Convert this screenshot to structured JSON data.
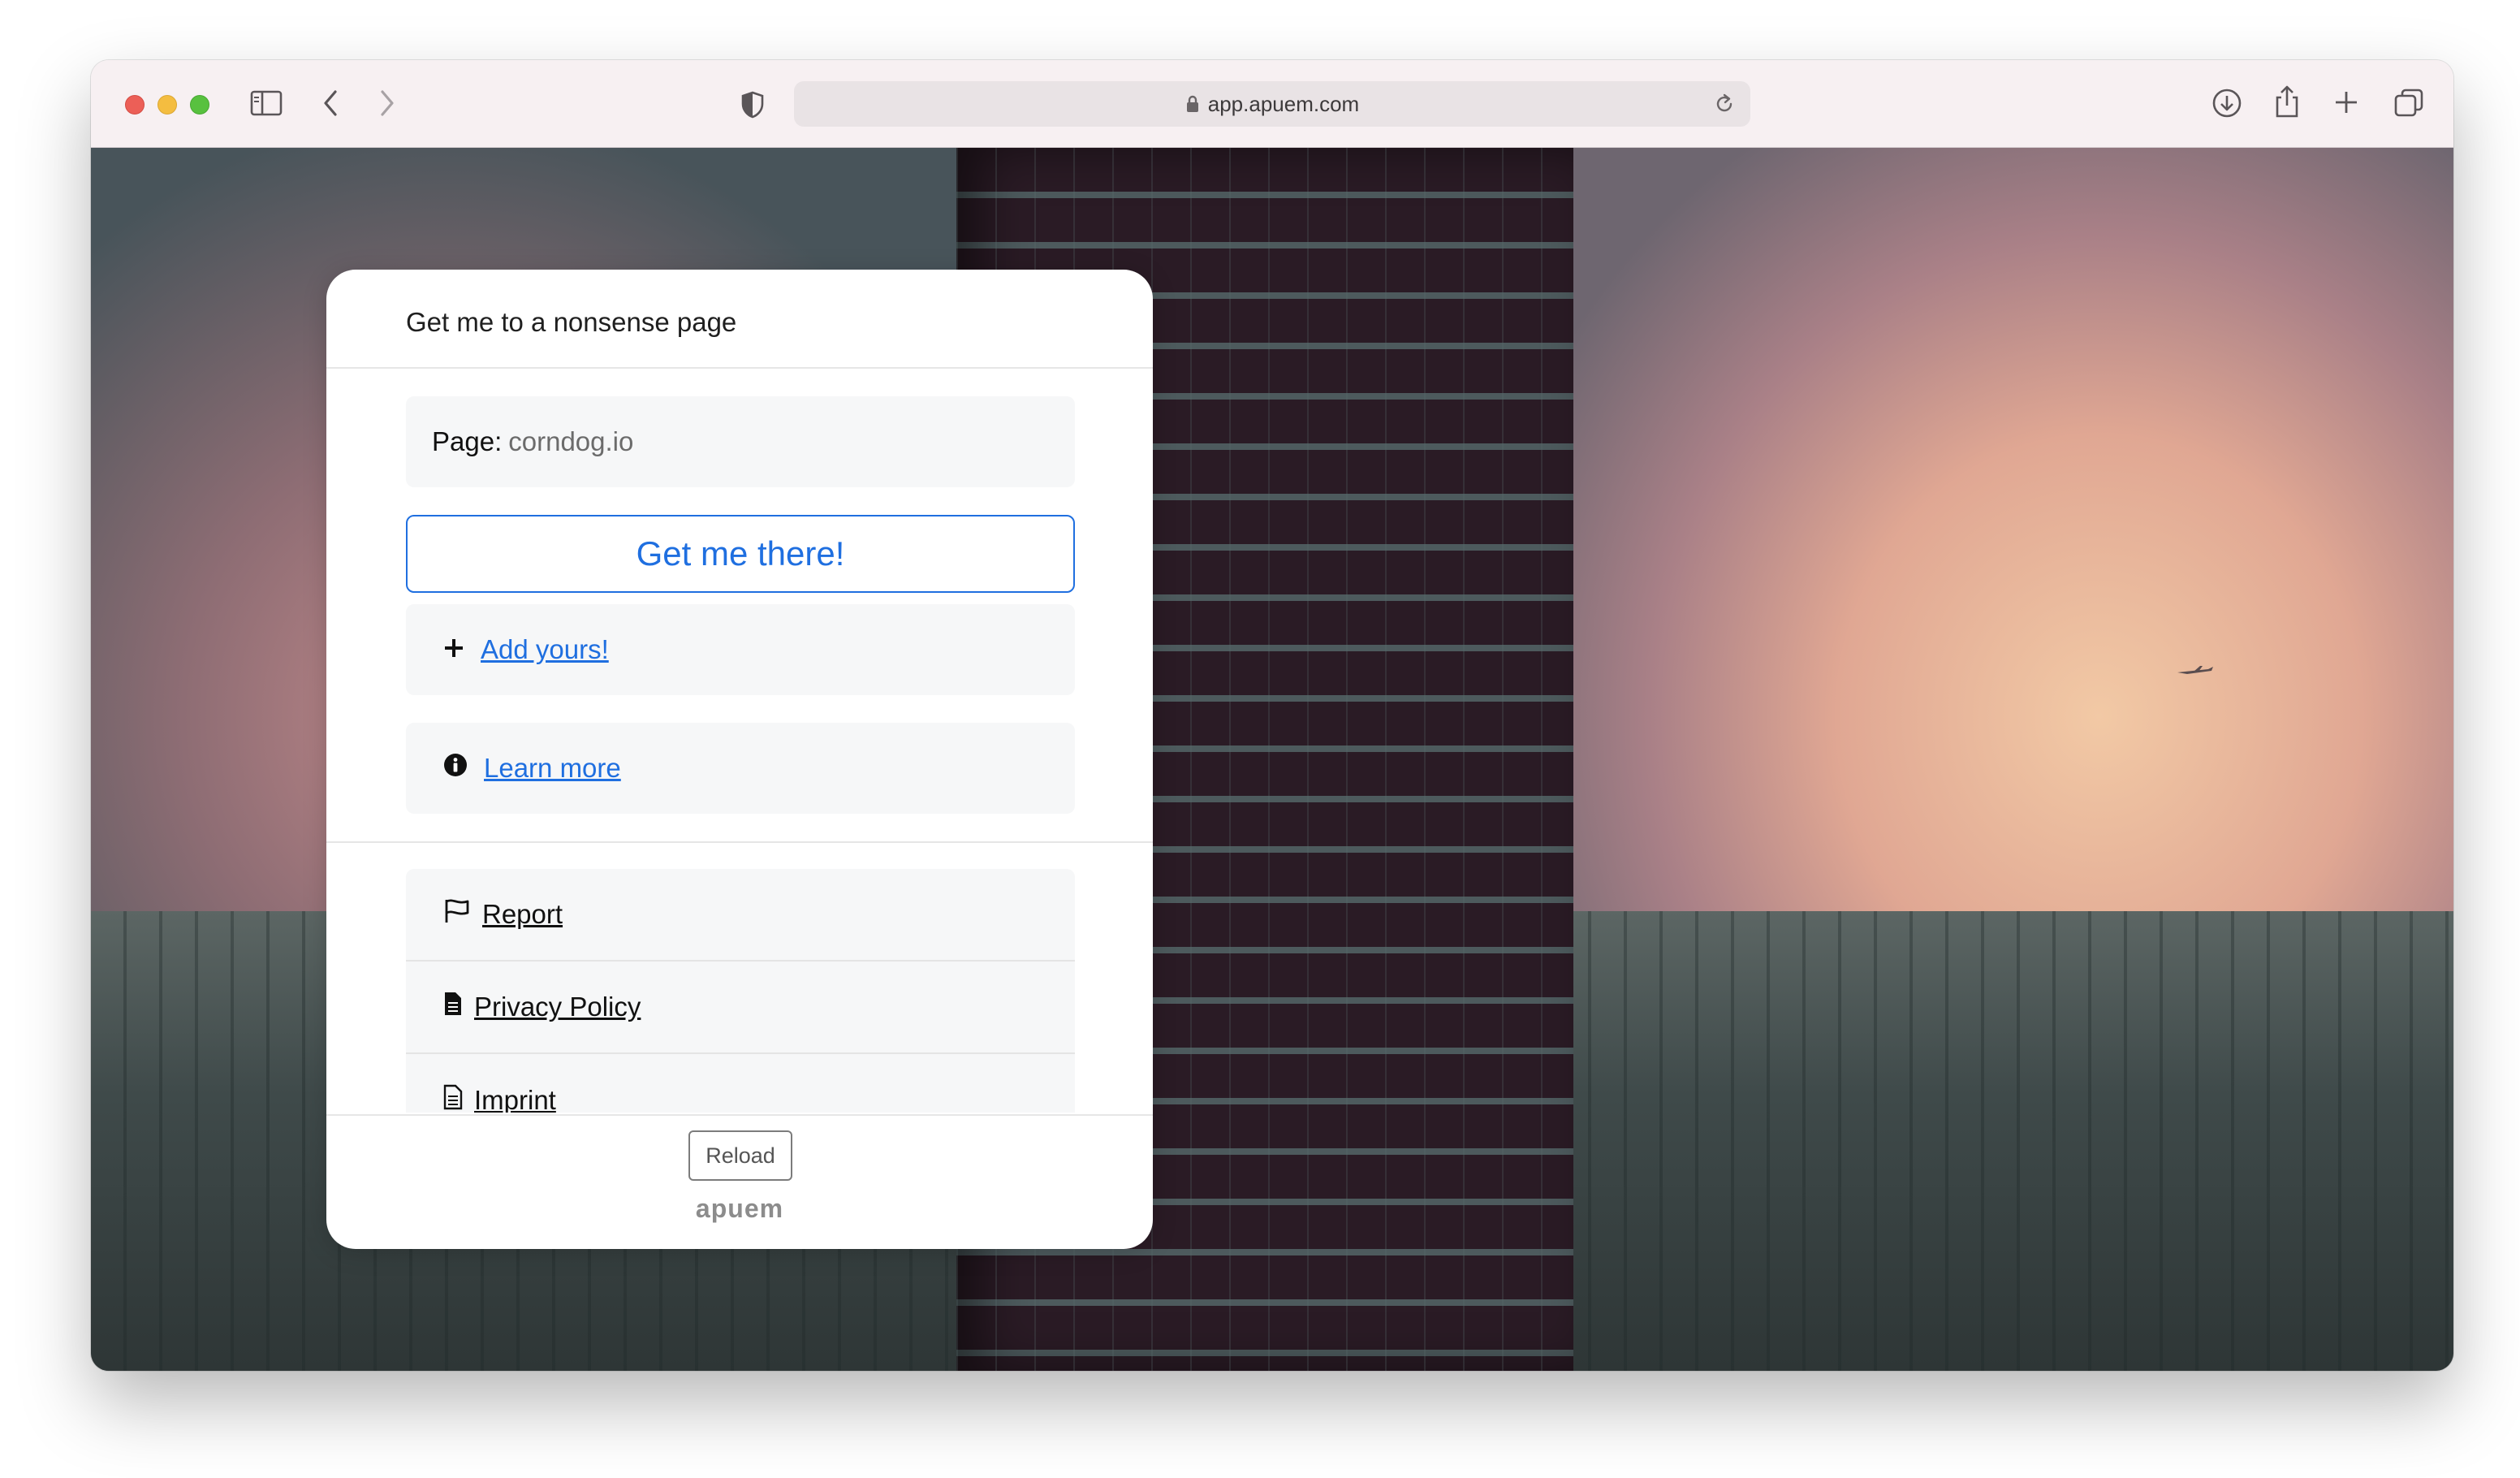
{
  "browser": {
    "url": "app.apuem.com"
  },
  "card": {
    "title": "Get me to a nonsense page",
    "page_label": "Page:",
    "page_value": "corndog.io",
    "go_button": "Get me there!",
    "add_link": "Add yours!",
    "learn_link": "Learn more",
    "list": [
      {
        "label": "Report",
        "icon": "flag-icon"
      },
      {
        "label": "Privacy Policy",
        "icon": "document-icon"
      },
      {
        "label": "Imprint",
        "icon": "document-outline-icon"
      }
    ],
    "reload_button": "Reload",
    "brand": "apuem"
  },
  "colors": {
    "accent": "#1f6fe0"
  }
}
